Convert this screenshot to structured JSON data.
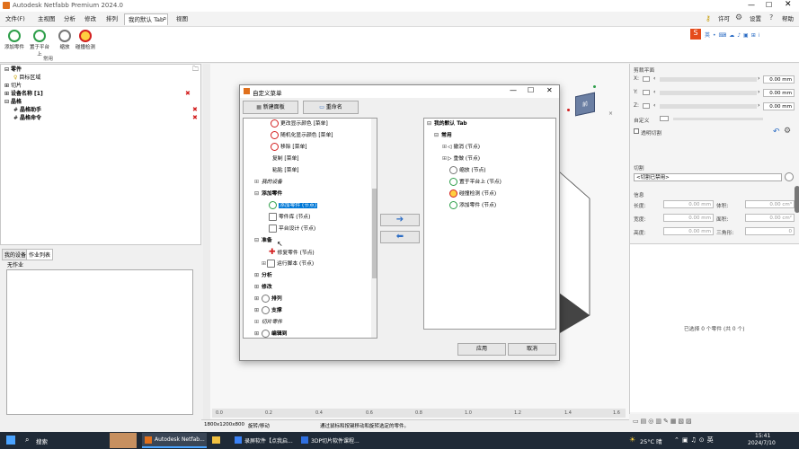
{
  "window": {
    "title": "Autodesk Netfabb Premium 2024.0"
  },
  "menu": [
    "文件(F)",
    "主视图",
    "分析",
    "修改",
    "排列",
    "我的默认 Tab",
    "视图"
  ],
  "header_right": {
    "license": "许可",
    "settings": "设置",
    "help": "帮助"
  },
  "ribbon": {
    "buttons": [
      "添加零件",
      "置于平台上",
      "缩放",
      "碰撞检测"
    ],
    "group": "常用"
  },
  "tree": {
    "items": [
      "零件",
      "目标区域",
      "切片",
      "设备名称 [1]",
      "晶格",
      "晶格助手",
      "晶格命令"
    ]
  },
  "left_tabs": [
    "我的设备",
    "作业列表"
  ],
  "job_list": {
    "title": "无作业"
  },
  "dialog": {
    "title": "自定义菜单",
    "new_tab": "新建面板",
    "rename": "重命名",
    "left_items": [
      "更改显示颜色 [菜单]",
      "随机化显示颜色 [菜单]",
      "移除 [菜单]",
      "复制 [菜单]",
      "粘贴 [菜单]",
      "我的设备",
      "添加零件",
      "添加零件 (节点)",
      "零件库 (节点)",
      "平台设计 (节点)",
      "准备",
      "修复零件 (节点)",
      "运行脚本 (节点)",
      "分析",
      "修改",
      "排列",
      "支撑",
      "切片零件",
      "编辑到"
    ],
    "right_root": "我的默认 Tab",
    "right_group": "常用",
    "right_items": [
      "撤消 (节点)",
      "重做 (节点)",
      "缩放 (节点)",
      "置于平台上 (节点)",
      "碰撞检测 (节点)",
      "添加零件 (节点)"
    ],
    "ok": "应用",
    "cancel": "取消"
  },
  "right_panel": {
    "section1": "剪裁平面",
    "axes": [
      {
        "label": "X:",
        "value": "0.00 mm"
      },
      {
        "label": "Y:",
        "value": "0.00 mm"
      },
      {
        "label": "Z:",
        "value": "0.00 mm"
      }
    ],
    "custom": "自定义",
    "transparent": "透明切割",
    "section2": "切割",
    "slice_select": "<切割已禁用>",
    "section3": "信息",
    "info": [
      {
        "l": "长度:",
        "v": "0.00 mm",
        "l2": "体积:",
        "v2": "0.00 cm³"
      },
      {
        "l": "宽度:",
        "v": "0.00 mm",
        "l2": "面积:",
        "v2": "0.00 cm²"
      },
      {
        "l": "高度:",
        "v": "0.00 mm",
        "l2": "三角形:",
        "v2": "0"
      }
    ],
    "selected": "已选择 0 个零件 (共 0 个)"
  },
  "viewport": {
    "cube_label": "前",
    "ruler": [
      "0.0",
      "0.2",
      "0.4",
      "0.6",
      "0.8",
      "1.0",
      "1.2",
      "1.4",
      "1.6"
    ]
  },
  "status": {
    "resolution": "1800x1200x800",
    "mode": "旋转/移动",
    "hint": "通过鼠标和按键移动和旋转选定的零件。"
  },
  "taskbar": {
    "search": "搜索",
    "apps": [
      "Autodesk Netfab...",
      "录屏软件【点我启...",
      "3DP切片软件课程..."
    ],
    "weather": "25°C 晴",
    "time": "15:41",
    "date": "2024/7/10"
  },
  "colors": {
    "accent": "#0078d7",
    "red": "#d32020",
    "green": "#2e9e4a"
  }
}
